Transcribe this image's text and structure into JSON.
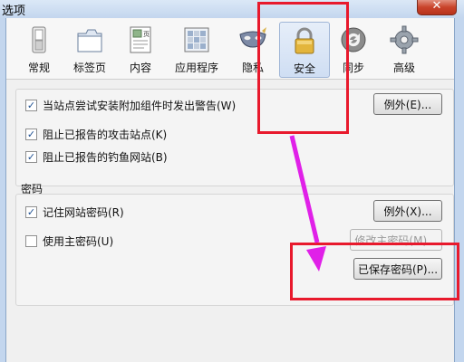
{
  "window": {
    "title": "选项",
    "close_glyph": "✕"
  },
  "tabs": [
    {
      "label": "常规",
      "icon": "switch-icon"
    },
    {
      "label": "标签页",
      "icon": "tabs-icon"
    },
    {
      "label": "内容",
      "icon": "content-icon"
    },
    {
      "label": "应用程序",
      "icon": "applications-icon"
    },
    {
      "label": "隐私",
      "icon": "privacy-mask-icon"
    },
    {
      "label": "安全",
      "icon": "padlock-icon",
      "selected": true
    },
    {
      "label": "同步",
      "icon": "sync-icon"
    },
    {
      "label": "高级",
      "icon": "gear-icon"
    }
  ],
  "security": {
    "warn_addons": {
      "label": "当站点尝试安装附加组件时发出警告(W)",
      "checked": true
    },
    "exceptions_button": "例外(E)...",
    "block_attack": {
      "label": "阻止已报告的攻击站点(K)",
      "checked": true
    },
    "block_forgery": {
      "label": "阻止已报告的钓鱼网站(B)",
      "checked": true
    }
  },
  "passwords": {
    "title": "密码",
    "remember": {
      "label": "记住网站密码(R)",
      "checked": true
    },
    "exceptions_button": "例外(X)...",
    "master": {
      "label": "使用主密码(U)",
      "checked": false
    },
    "change_master_button": "修改主密码(M)...",
    "saved_button": "已保存密码(P)..."
  },
  "colors": {
    "annotation_red": "#e8192c",
    "arrow_magenta": "#e020e8"
  }
}
